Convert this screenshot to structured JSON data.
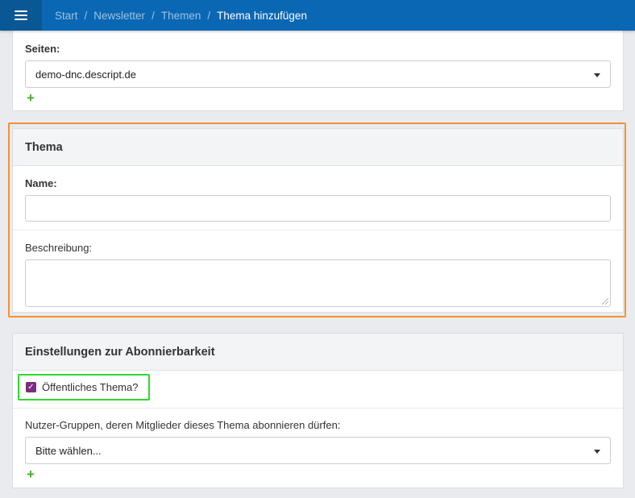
{
  "header": {
    "menu_icon": "hamburger-icon",
    "breadcrumb": [
      "Start",
      "Newsletter",
      "Themen"
    ],
    "current": "Thema hinzufügen",
    "separator": "/",
    "accent_color": "#0a67b3"
  },
  "seiten": {
    "label": "Seiten:",
    "selected": "demo-dnc.descript.de",
    "add_icon": "plus-icon"
  },
  "thema": {
    "title": "Thema",
    "name_label": "Name:",
    "name_value": "",
    "description_label": "Beschreibung:",
    "description_value": ""
  },
  "abo": {
    "title": "Einstellungen zur Abonnierbarkeit",
    "public_checkbox_label": "Öffentliches Thema?",
    "public_checked": true,
    "groups_label": "Nutzer-Gruppen, deren Mitglieder dieses Thema abonnieren dürfen:",
    "groups_placeholder": "Bitte wählen...",
    "add_icon": "plus-icon"
  },
  "highlight_colors": {
    "thema_card": "#f5922e",
    "public_checkbox": "#2fd82f"
  }
}
